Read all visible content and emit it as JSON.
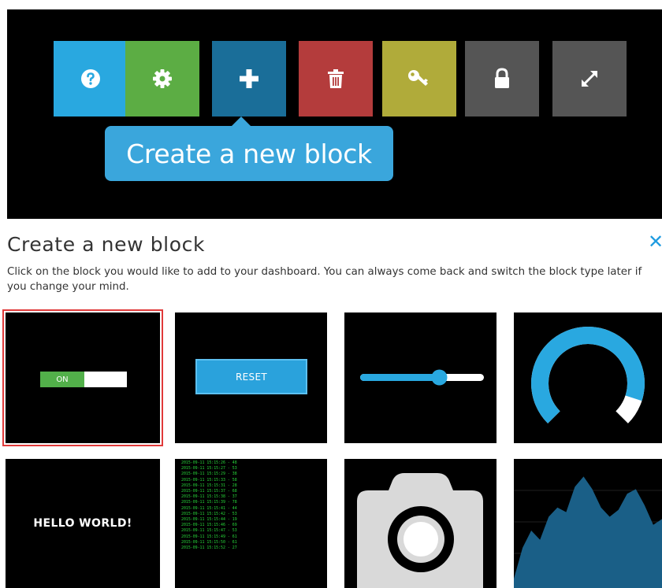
{
  "toolbar": {
    "buttons": [
      {
        "name": "help",
        "icon": "question-icon",
        "color": "#29a8e0"
      },
      {
        "name": "settings",
        "icon": "gear-icon",
        "color": "#5cad44"
      },
      {
        "name": "add",
        "icon": "plus-icon",
        "color": "#1a6e99"
      },
      {
        "name": "delete",
        "icon": "trash-icon",
        "color": "#b43c3c"
      },
      {
        "name": "key",
        "icon": "key-icon",
        "color": "#b0ab3a"
      },
      {
        "name": "lock",
        "icon": "lock-icon",
        "color": "#555555"
      },
      {
        "name": "fullscreen",
        "icon": "expand-icon",
        "color": "#555555"
      }
    ],
    "tooltip": "Create a new block"
  },
  "dialog": {
    "title": "Create a new block",
    "close_icon": "close-icon",
    "description": "Click on the block you would like to add to your dashboard. You can always come back and switch the block type later if you change your mind.",
    "tiles": {
      "toggle": {
        "on_label": "ON"
      },
      "reset": {
        "label": "RESET"
      },
      "slider": {
        "value_fraction": 0.64
      },
      "gauge": {
        "value_fraction": 0.9
      },
      "text": {
        "label": "HELLO WORLD!"
      },
      "log": {
        "lines": [
          "2015-09-11 15:15:26 - 48",
          "2015-09-11 15:15:27 - 53",
          "2015-09-11 15:15:29 - 38",
          "2015-09-11 15:15:33 - 58",
          "2015-09-11 15:15:31 - 28",
          "2015-09-11 15:15:37 - 68",
          "2015-09-11 15:15:38 - 37",
          "2015-09-11 15:15:39 - 78",
          "2015-09-11 15:15:41 - 44",
          "2015-09-11 15:15:42 - 53",
          "2015-09-11 15:15:44 - 19",
          "2015-09-11 15:15:46 - 69",
          "2015-09-11 15:15:47 - 53",
          "2015-09-11 15:15:49 - 61",
          "2015-09-11 15:15:50 - 61",
          "2015-09-11 15:15:52 - 27"
        ]
      },
      "camera": {
        "icon": "camera-icon"
      },
      "chart": {
        "color": "#1a5f87",
        "values": [
          0.08,
          0.35,
          0.5,
          0.42,
          0.62,
          0.7,
          0.66,
          0.88,
          0.97,
          0.86,
          0.7,
          0.62,
          0.68,
          0.82,
          0.86,
          0.72,
          0.55,
          0.6
        ]
      }
    }
  }
}
